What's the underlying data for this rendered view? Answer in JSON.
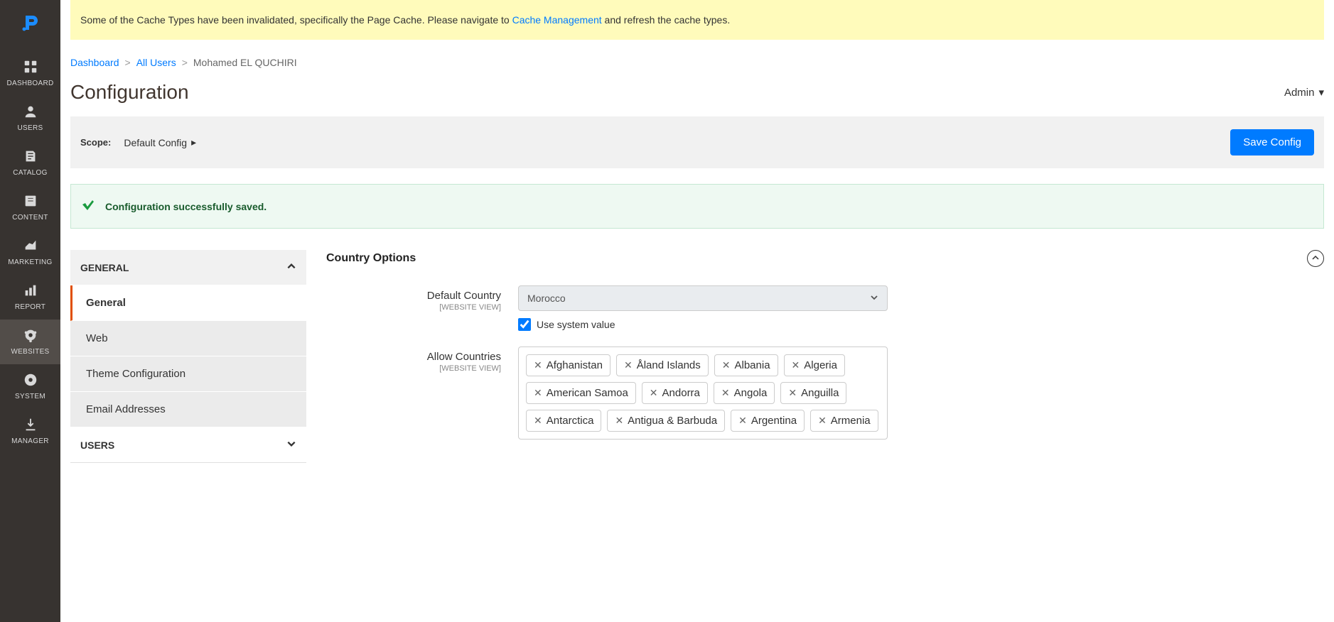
{
  "notice": {
    "prefix": "Some of the Cache Types have been invalidated, specifically the Page Cache. Please navigate to ",
    "link": "Cache Management",
    "suffix": " and refresh the cache types."
  },
  "sidebar": {
    "items": [
      {
        "label": "DASHBOARD",
        "icon": "dashboard"
      },
      {
        "label": "USERS",
        "icon": "users"
      },
      {
        "label": "CATALOG",
        "icon": "catalog"
      },
      {
        "label": "CONTENT",
        "icon": "content"
      },
      {
        "label": "MARKETING",
        "icon": "marketing"
      },
      {
        "label": "REPORT",
        "icon": "report"
      },
      {
        "label": "WEBSITES",
        "icon": "websites",
        "active": true
      },
      {
        "label": "SYSTEM",
        "icon": "system"
      },
      {
        "label": "MANAGER",
        "icon": "manager"
      }
    ]
  },
  "breadcrumb": {
    "items": [
      {
        "label": "Dashboard",
        "link": true
      },
      {
        "label": "All Users",
        "link": true
      },
      {
        "label": "Mohamed EL QUCHIRI",
        "link": false
      }
    ]
  },
  "page_title": "Configuration",
  "admin_label": "Admin",
  "scope": {
    "label": "Scope:",
    "value": "Default Config"
  },
  "save_label": "Save Config",
  "success_msg": "Configuration successfully saved.",
  "config_nav": {
    "sections": [
      {
        "label": "GENERAL",
        "open": true,
        "items": [
          {
            "label": "General",
            "active": true
          },
          {
            "label": "Web"
          },
          {
            "label": "Theme Configuration"
          },
          {
            "label": "Email Addresses"
          }
        ]
      },
      {
        "label": "USERS",
        "open": false,
        "items": []
      }
    ]
  },
  "section_title": "Country Options",
  "fields": {
    "default_country": {
      "label": "Default Country",
      "sublabel": "[WEBSITE VIEW]",
      "value": "Morocco",
      "use_system_label": "Use system value"
    },
    "allow_countries": {
      "label": "Allow Countries",
      "sublabel": "[WEBSITE VIEW]",
      "values": [
        "Afghanistan",
        "Åland Islands",
        "Albania",
        "Algeria",
        "American Samoa",
        "Andorra",
        "Angola",
        "Anguilla",
        "Antarctica",
        "Antigua & Barbuda",
        "Argentina",
        "Armenia"
      ]
    }
  }
}
